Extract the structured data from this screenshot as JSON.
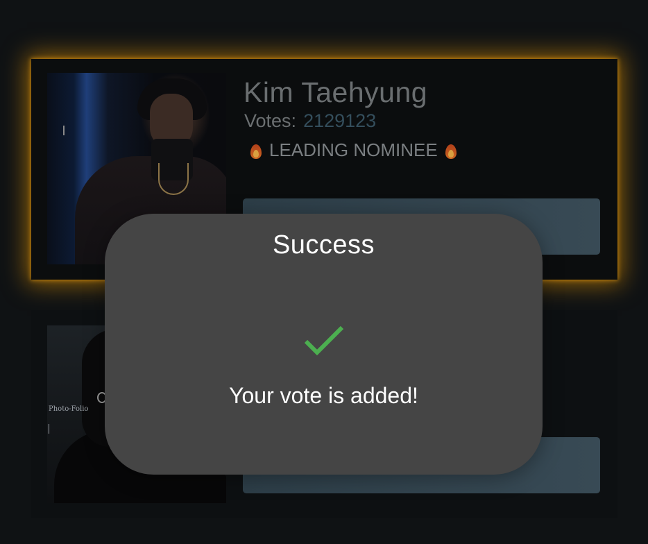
{
  "nominees": [
    {
      "name": "Kim Taehyung",
      "votes_label": "Votes:",
      "votes_value": "2129123",
      "badge": "LEADING NOMINEE",
      "badge_icon": "fire-icon",
      "highlight_color": "#ffa500"
    },
    {
      "photo_watermark": "Photo-Folio"
    }
  ],
  "modal": {
    "title": "Success",
    "icon": "checkmark-icon",
    "icon_color": "#4caf50",
    "message": "Your vote is added!"
  }
}
